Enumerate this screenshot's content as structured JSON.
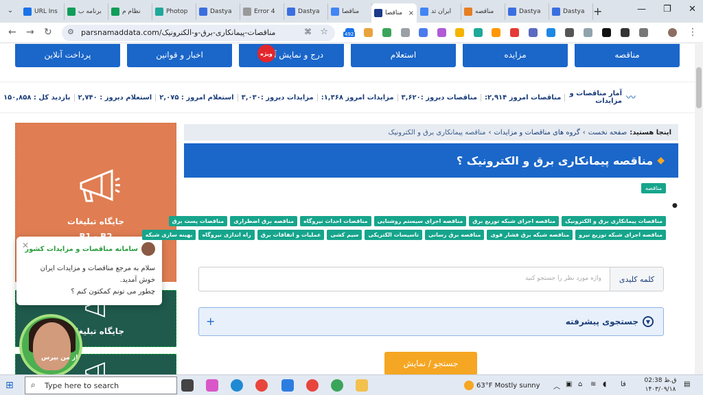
{
  "browser": {
    "tabs": [
      {
        "label": "URL Ins",
        "fav_color": "#1a73e8"
      },
      {
        "label": "برنامه ب",
        "fav_color": "#0f9d58"
      },
      {
        "label": "نظام م",
        "fav_color": "#0f9d58"
      },
      {
        "label": "Photop",
        "fav_color": "#1fa89a"
      },
      {
        "label": "Dastya",
        "fav_color": "#3b6fe0"
      },
      {
        "label": "Error 4",
        "fav_color": "#999999"
      },
      {
        "label": "Dastya",
        "fav_color": "#3b6fe0"
      },
      {
        "label": "مناقصا",
        "fav_color": "#4285f4"
      },
      {
        "label": "مناقصا",
        "fav_color": "#1b3a8a",
        "active": true
      },
      {
        "label": "ایران تد",
        "fav_color": "#4285f4"
      },
      {
        "label": "مناقصه",
        "fav_color": "#e67e22"
      },
      {
        "label": "Dastya",
        "fav_color": "#3b6fe0"
      },
      {
        "label": "Dastya",
        "fav_color": "#3b6fe0"
      }
    ],
    "close_glyph": "×",
    "newtab_glyph": "+",
    "url": "parsnamaddata.com/مناقصات-پیمانکاری-برق-و-الکترونیک",
    "ext_badge": "492"
  },
  "page": {
    "nav_buttons": [
      "مناقصه",
      "مزایده",
      "استعلام",
      "درج و نمایش آگهی",
      "اخبار و قوانین",
      "پرداخت آنلاین"
    ],
    "badge": "ویژه",
    "stats": {
      "title": "آمار مناقصات و مزایدات",
      "items": [
        "مناقصات امروز ۲,۹۱۴:",
        "مناقصات دیروز :۳,۶۲۰",
        "مزایدات امروز ۱,۳۶۸:",
        "مزایدات دیروز :۳,۰۳۰",
        "استعلام امروز : ۲,۰۷۵",
        "استعلام دیروز : ۲,۷۴۰",
        "بازدید کل : ۱۵۰,۸۵۸"
      ]
    },
    "breadcrumb": {
      "prefix": "اینجا هستید:",
      "items": [
        "صفحه نخست",
        "گروه های مناقصات و مزایدات",
        "مناقصه پیمانکاری برق و الکترونیک"
      ],
      "sep": "›"
    },
    "title": "مناقصه پیمانکاری برق و الکترونیک ؟",
    "category": "مناقصه",
    "tags_row1": [
      "مناقصات پیمانکاری برق و الکترونیک",
      "مناقصه اجرای شبکه توزیع برق",
      "مناقصه اجرای سیستم روشنایی",
      "مناقصات احداث نیروگاه",
      "مناقصه برق اضطراری",
      "مناقصات پست برق"
    ],
    "tags_row2": [
      "مناقصه اجرای شبکه توزیع نیرو",
      "مناقصه شبکه برق فشار قوی",
      "مناقصه برق رسانی",
      "تاسیسات الکتریکی",
      "سیم کشی",
      "عملیات و اتفاقات برق",
      "راه اندازی نیروگاه",
      "بهینه سازی شبکه"
    ],
    "keyword_label": "کلمه کلیدی",
    "keyword_placeholder": "واژه مورد نظر را جستجو کنید",
    "advanced_search": "جستجوی پیشرفته",
    "search_button": "جستجو / نمایش",
    "ad_label": "جایگاه تبلیغات",
    "ad_sub": "B1 - B2",
    "chat": {
      "title": "سامانه مناقصات و مزایدات کشور",
      "message": "سلام به مرجع مناقصات و مزایدات ایران خوش آمدید.",
      "question": "چطور می تونم کمکتون کنم ؟",
      "caption": "از من بپرس"
    }
  },
  "taskbar": {
    "search_placeholder": "Type here to search",
    "weather": "63°F  Mostly sunny",
    "lang": "فا",
    "time": "ق.ظ 02:38",
    "date": "۱۴۰۳/۰۹/۱۸"
  }
}
